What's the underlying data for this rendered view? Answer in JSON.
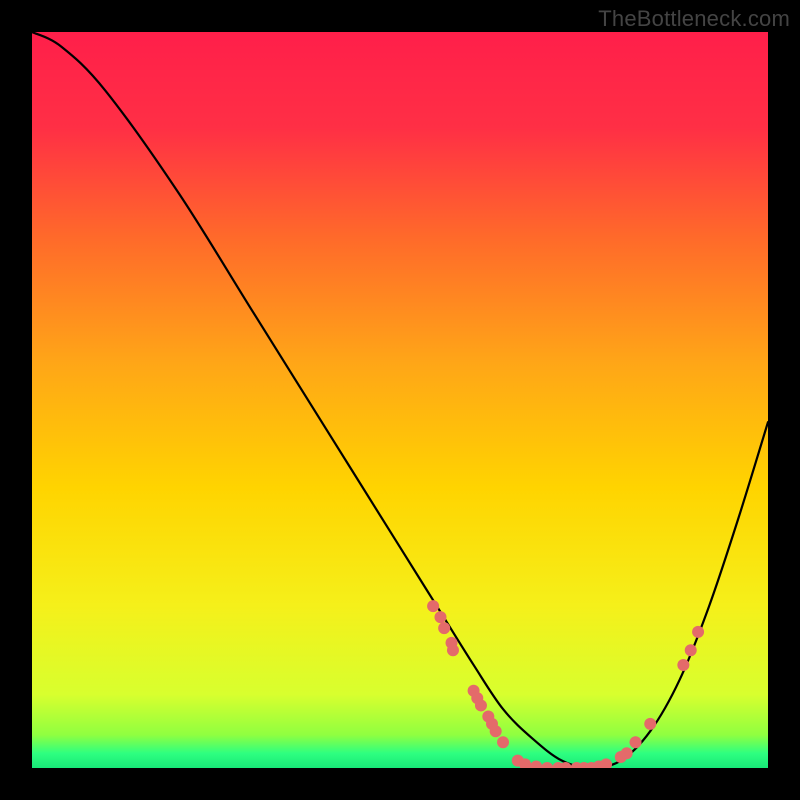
{
  "watermark": "TheBottleneck.com",
  "colors": {
    "bg": "#000000",
    "grad_top": "#ff1f4a",
    "grad_mid": "#ffd400",
    "grad_bottom1": "#d8ff2e",
    "grad_bottom2": "#2eff80",
    "curve": "#000000",
    "dot": "#e46a6a"
  },
  "chart_data": {
    "type": "line",
    "title": "",
    "xlabel": "",
    "ylabel": "",
    "xlim": [
      0,
      100
    ],
    "ylim": [
      0,
      100
    ],
    "grid": false,
    "legend": false,
    "series": [
      {
        "name": "bottleneck-curve",
        "x": [
          0,
          4,
          10,
          20,
          30,
          40,
          50,
          55,
          60,
          64,
          68,
          72,
          76,
          80,
          84,
          88,
          92,
          96,
          100
        ],
        "y": [
          100,
          98,
          92,
          78,
          62,
          46,
          30,
          22,
          14,
          8,
          4,
          1,
          0,
          1,
          5,
          12,
          22,
          34,
          47
        ]
      }
    ],
    "markers": [
      {
        "x": 54.5,
        "y": 22.0
      },
      {
        "x": 55.5,
        "y": 20.5
      },
      {
        "x": 56.0,
        "y": 19.0
      },
      {
        "x": 57.0,
        "y": 17.0
      },
      {
        "x": 57.2,
        "y": 16.0
      },
      {
        "x": 60.0,
        "y": 10.5
      },
      {
        "x": 60.5,
        "y": 9.5
      },
      {
        "x": 61.0,
        "y": 8.5
      },
      {
        "x": 62.0,
        "y": 7.0
      },
      {
        "x": 62.5,
        "y": 6.0
      },
      {
        "x": 63.0,
        "y": 5.0
      },
      {
        "x": 64.0,
        "y": 3.5
      },
      {
        "x": 66.0,
        "y": 1.0
      },
      {
        "x": 67.0,
        "y": 0.5
      },
      {
        "x": 68.5,
        "y": 0.2
      },
      {
        "x": 70.0,
        "y": 0.0
      },
      {
        "x": 71.5,
        "y": 0.0
      },
      {
        "x": 72.5,
        "y": 0.0
      },
      {
        "x": 74.0,
        "y": 0.0
      },
      {
        "x": 75.0,
        "y": 0.0
      },
      {
        "x": 76.0,
        "y": 0.0
      },
      {
        "x": 77.0,
        "y": 0.2
      },
      {
        "x": 78.0,
        "y": 0.5
      },
      {
        "x": 80.0,
        "y": 1.5
      },
      {
        "x": 80.8,
        "y": 2.0
      },
      {
        "x": 82.0,
        "y": 3.5
      },
      {
        "x": 84.0,
        "y": 6.0
      },
      {
        "x": 88.5,
        "y": 14.0
      },
      {
        "x": 89.5,
        "y": 16.0
      },
      {
        "x": 90.5,
        "y": 18.5
      }
    ]
  }
}
